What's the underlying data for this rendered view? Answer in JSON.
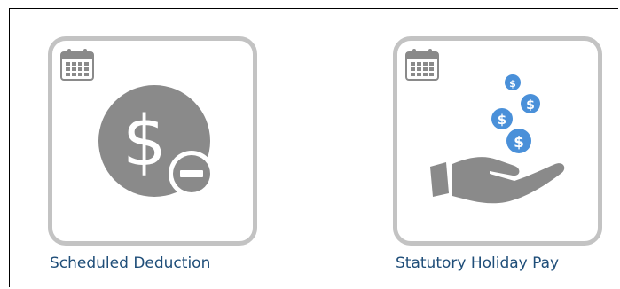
{
  "tiles": [
    {
      "label": "Scheduled Deduction",
      "icon": "dollar-minus-icon",
      "badge_icon": "calendar-icon"
    },
    {
      "label": "Statutory Holiday Pay",
      "icon": "hand-coins-icon",
      "badge_icon": "calendar-icon"
    }
  ],
  "colors": {
    "tile_border": "#c3c3c3",
    "icon_gray": "#8a8a8a",
    "coin_blue": "#4a90d9",
    "label_text": "#1f4e79"
  }
}
